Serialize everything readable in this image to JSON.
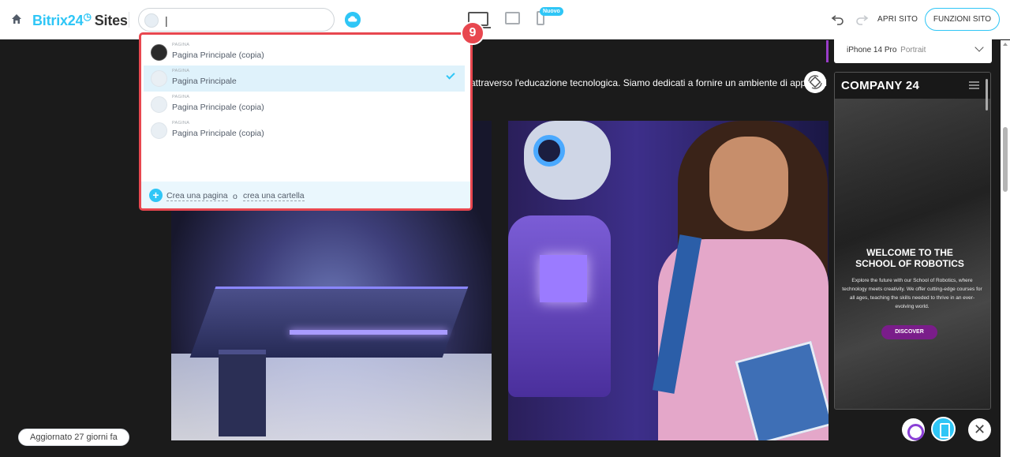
{
  "header": {
    "brand_name": "Bitrix24",
    "brand_suffix": "Sites",
    "page_input_value": "|",
    "new_badge": "Nuovo",
    "open_site": "APRI SITO",
    "site_functions": "FUNZIONI SITO"
  },
  "dropdown": {
    "items": [
      {
        "type": "PAGINA",
        "title": "Pagina Principale (copia)",
        "thumb": "dark",
        "selected": false
      },
      {
        "type": "PAGINA",
        "title": "Pagina Principale",
        "thumb": "light",
        "selected": true
      },
      {
        "type": "PAGINA",
        "title": "Pagina Principale (copia)",
        "thumb": "light",
        "selected": false
      },
      {
        "type": "PAGINA",
        "title": "Pagina Principale (copia)",
        "thumb": "light",
        "selected": false
      }
    ],
    "create_page": "Crea una pagina",
    "or": "o",
    "create_folder": "crea una cartella"
  },
  "step_badge": "9",
  "canvas": {
    "hero_text": "attraverso l'educazione tecnologica. Siamo dedicati a fornire un ambiente di apprendi"
  },
  "preview": {
    "device": "iPhone 14 Pro",
    "orientation": "Portrait",
    "logo": "COMPANY 24",
    "title_line1": "WELCOME TO THE",
    "title_line2": "SCHOOL OF ROBOTICS",
    "description": "Explore the future with our School of Robotics, where technology meets creativity. We offer cutting-edge courses for all ages, teaching the skills needed to thrive in an ever-evolving world.",
    "cta": "DISCOVER"
  },
  "status": {
    "updated": "Aggiornato 27 giorni fa"
  },
  "colors": {
    "accent": "#2fc6f6",
    "highlight_border": "#e8474f",
    "cta": "#7a1d8a"
  }
}
